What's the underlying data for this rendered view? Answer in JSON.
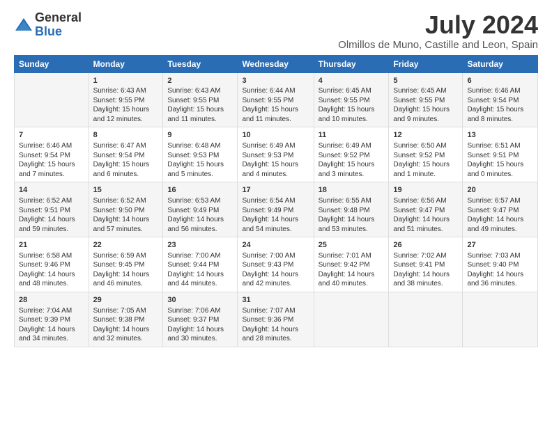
{
  "logo": {
    "general": "General",
    "blue": "Blue"
  },
  "title": "July 2024",
  "subtitle": "Olmillos de Muno, Castille and Leon, Spain",
  "days": [
    "Sunday",
    "Monday",
    "Tuesday",
    "Wednesday",
    "Thursday",
    "Friday",
    "Saturday"
  ],
  "weeks": [
    [
      {
        "num": "",
        "lines": []
      },
      {
        "num": "1",
        "lines": [
          "Sunrise: 6:43 AM",
          "Sunset: 9:55 PM",
          "Daylight: 15 hours",
          "and 12 minutes."
        ]
      },
      {
        "num": "2",
        "lines": [
          "Sunrise: 6:43 AM",
          "Sunset: 9:55 PM",
          "Daylight: 15 hours",
          "and 11 minutes."
        ]
      },
      {
        "num": "3",
        "lines": [
          "Sunrise: 6:44 AM",
          "Sunset: 9:55 PM",
          "Daylight: 15 hours",
          "and 11 minutes."
        ]
      },
      {
        "num": "4",
        "lines": [
          "Sunrise: 6:45 AM",
          "Sunset: 9:55 PM",
          "Daylight: 15 hours",
          "and 10 minutes."
        ]
      },
      {
        "num": "5",
        "lines": [
          "Sunrise: 6:45 AM",
          "Sunset: 9:55 PM",
          "Daylight: 15 hours",
          "and 9 minutes."
        ]
      },
      {
        "num": "6",
        "lines": [
          "Sunrise: 6:46 AM",
          "Sunset: 9:54 PM",
          "Daylight: 15 hours",
          "and 8 minutes."
        ]
      }
    ],
    [
      {
        "num": "7",
        "lines": [
          "Sunrise: 6:46 AM",
          "Sunset: 9:54 PM",
          "Daylight: 15 hours",
          "and 7 minutes."
        ]
      },
      {
        "num": "8",
        "lines": [
          "Sunrise: 6:47 AM",
          "Sunset: 9:54 PM",
          "Daylight: 15 hours",
          "and 6 minutes."
        ]
      },
      {
        "num": "9",
        "lines": [
          "Sunrise: 6:48 AM",
          "Sunset: 9:53 PM",
          "Daylight: 15 hours",
          "and 5 minutes."
        ]
      },
      {
        "num": "10",
        "lines": [
          "Sunrise: 6:49 AM",
          "Sunset: 9:53 PM",
          "Daylight: 15 hours",
          "and 4 minutes."
        ]
      },
      {
        "num": "11",
        "lines": [
          "Sunrise: 6:49 AM",
          "Sunset: 9:52 PM",
          "Daylight: 15 hours",
          "and 3 minutes."
        ]
      },
      {
        "num": "12",
        "lines": [
          "Sunrise: 6:50 AM",
          "Sunset: 9:52 PM",
          "Daylight: 15 hours",
          "and 1 minute."
        ]
      },
      {
        "num": "13",
        "lines": [
          "Sunrise: 6:51 AM",
          "Sunset: 9:51 PM",
          "Daylight: 15 hours",
          "and 0 minutes."
        ]
      }
    ],
    [
      {
        "num": "14",
        "lines": [
          "Sunrise: 6:52 AM",
          "Sunset: 9:51 PM",
          "Daylight: 14 hours",
          "and 59 minutes."
        ]
      },
      {
        "num": "15",
        "lines": [
          "Sunrise: 6:52 AM",
          "Sunset: 9:50 PM",
          "Daylight: 14 hours",
          "and 57 minutes."
        ]
      },
      {
        "num": "16",
        "lines": [
          "Sunrise: 6:53 AM",
          "Sunset: 9:49 PM",
          "Daylight: 14 hours",
          "and 56 minutes."
        ]
      },
      {
        "num": "17",
        "lines": [
          "Sunrise: 6:54 AM",
          "Sunset: 9:49 PM",
          "Daylight: 14 hours",
          "and 54 minutes."
        ]
      },
      {
        "num": "18",
        "lines": [
          "Sunrise: 6:55 AM",
          "Sunset: 9:48 PM",
          "Daylight: 14 hours",
          "and 53 minutes."
        ]
      },
      {
        "num": "19",
        "lines": [
          "Sunrise: 6:56 AM",
          "Sunset: 9:47 PM",
          "Daylight: 14 hours",
          "and 51 minutes."
        ]
      },
      {
        "num": "20",
        "lines": [
          "Sunrise: 6:57 AM",
          "Sunset: 9:47 PM",
          "Daylight: 14 hours",
          "and 49 minutes."
        ]
      }
    ],
    [
      {
        "num": "21",
        "lines": [
          "Sunrise: 6:58 AM",
          "Sunset: 9:46 PM",
          "Daylight: 14 hours",
          "and 48 minutes."
        ]
      },
      {
        "num": "22",
        "lines": [
          "Sunrise: 6:59 AM",
          "Sunset: 9:45 PM",
          "Daylight: 14 hours",
          "and 46 minutes."
        ]
      },
      {
        "num": "23",
        "lines": [
          "Sunrise: 7:00 AM",
          "Sunset: 9:44 PM",
          "Daylight: 14 hours",
          "and 44 minutes."
        ]
      },
      {
        "num": "24",
        "lines": [
          "Sunrise: 7:00 AM",
          "Sunset: 9:43 PM",
          "Daylight: 14 hours",
          "and 42 minutes."
        ]
      },
      {
        "num": "25",
        "lines": [
          "Sunrise: 7:01 AM",
          "Sunset: 9:42 PM",
          "Daylight: 14 hours",
          "and 40 minutes."
        ]
      },
      {
        "num": "26",
        "lines": [
          "Sunrise: 7:02 AM",
          "Sunset: 9:41 PM",
          "Daylight: 14 hours",
          "and 38 minutes."
        ]
      },
      {
        "num": "27",
        "lines": [
          "Sunrise: 7:03 AM",
          "Sunset: 9:40 PM",
          "Daylight: 14 hours",
          "and 36 minutes."
        ]
      }
    ],
    [
      {
        "num": "28",
        "lines": [
          "Sunrise: 7:04 AM",
          "Sunset: 9:39 PM",
          "Daylight: 14 hours",
          "and 34 minutes."
        ]
      },
      {
        "num": "29",
        "lines": [
          "Sunrise: 7:05 AM",
          "Sunset: 9:38 PM",
          "Daylight: 14 hours",
          "and 32 minutes."
        ]
      },
      {
        "num": "30",
        "lines": [
          "Sunrise: 7:06 AM",
          "Sunset: 9:37 PM",
          "Daylight: 14 hours",
          "and 30 minutes."
        ]
      },
      {
        "num": "31",
        "lines": [
          "Sunrise: 7:07 AM",
          "Sunset: 9:36 PM",
          "Daylight: 14 hours",
          "and 28 minutes."
        ]
      },
      {
        "num": "",
        "lines": []
      },
      {
        "num": "",
        "lines": []
      },
      {
        "num": "",
        "lines": []
      }
    ]
  ]
}
